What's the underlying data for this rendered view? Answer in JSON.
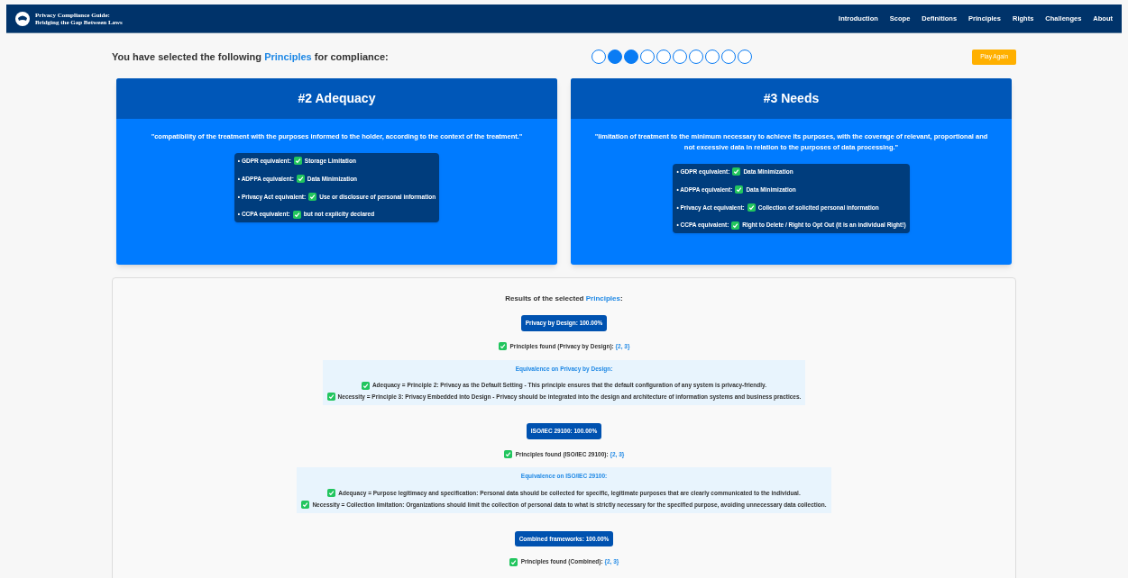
{
  "navbar": {
    "brand": [
      "Privacy Compliance Guide:",
      "Bridging the Gap Between Laws"
    ],
    "links": [
      "Introduction",
      "Scope",
      "Definitions",
      "Principles",
      "Rights",
      "Challenges",
      "About"
    ]
  },
  "selection": {
    "heading_before": "You have selected the following",
    "heading_highlight": "Principles",
    "heading_after": "for compliance:",
    "steps": [
      {
        "selected": false
      },
      {
        "selected": true
      },
      {
        "selected": true
      },
      {
        "selected": false
      },
      {
        "selected": false
      },
      {
        "selected": false
      },
      {
        "selected": false
      },
      {
        "selected": false
      },
      {
        "selected": false
      },
      {
        "selected": false
      }
    ],
    "play_again": "Play Again"
  },
  "cards": [
    {
      "title": "#2 Adequacy",
      "quote": "\"compatibility of the treatment with the purposes informed to the holder, according to the context of the treatment.\"",
      "equivalents": [
        {
          "label": "• GDPR equivalent:",
          "checked": true,
          "value": "Storage Limitation"
        },
        {
          "label": "• ADPPA equivalent:",
          "checked": true,
          "value": "Data Minimization"
        },
        {
          "label": "• Privacy Act equivalent:",
          "checked": true,
          "value": "Use or disclosure of personal information"
        },
        {
          "label": "• CCPA equivalent:",
          "checked": true,
          "value": "but not explicity declared"
        }
      ]
    },
    {
      "title": "#3 Needs",
      "quote": "\"limitation of treatment to the minimum necessary to achieve its purposes, with the coverage of relevant, proportional and not excessive data in relation to the purposes of data processing.\"",
      "equivalents": [
        {
          "label": "• GDPR equivalent:",
          "checked": true,
          "value": "Data Minimization"
        },
        {
          "label": "• ADPPA equivalent:",
          "checked": true,
          "value": "Data Minimization"
        },
        {
          "label": "• Privacy Act equivalent:",
          "checked": true,
          "value": "Collection of solicited personal information"
        },
        {
          "label": "• CCPA equivalent:",
          "checked": true,
          "value": "Right to Delete / Right to Opt Out (it is an individual Right!)"
        }
      ]
    }
  ],
  "results": {
    "heading_before": "Results of the selected",
    "heading_highlight": "Principles",
    "heading_after": ":",
    "frameworks": [
      {
        "badge": "Privacy by Design: 100.00%",
        "found_label": "Principles found (Privacy by Design):",
        "found_value": "{2, 3}",
        "equivalence_title": "Equivalence on Privacy by Design:",
        "equivalences": [
          {
            "checked": true,
            "text": "Adequacy = Principle 2: Privacy as the Default Setting - This principle ensures that the default configuration of any system is privacy-friendly."
          },
          {
            "checked": true,
            "text": "Necessity = Principle 3: Privacy Embedded into Design - Privacy should be integrated into the design and architecture of information systems and business practices."
          }
        ]
      },
      {
        "badge": "ISO/IEC 29100: 100.00%",
        "found_label": "Principles found (ISO/IEC 29100):",
        "found_value": "{2, 3}",
        "equivalence_title": "Equivalence on ISO/IEC 29100:",
        "equivalences": [
          {
            "checked": true,
            "text": "Adequacy = Purpose legitimacy and specification: Personal data should be collected for specific, legitimate purposes that are clearly communicated to the individual."
          },
          {
            "checked": true,
            "text": "Necessity = Collection limitation: Organizations should limit the collection of personal data to what is strictly necessary for the specified purpose, avoiding unnecessary data collection."
          }
        ]
      },
      {
        "badge": "Combined frameworks: 100.00%",
        "found_label": "Principles found (Combined):",
        "found_value": "{2, 3}"
      }
    ]
  }
}
